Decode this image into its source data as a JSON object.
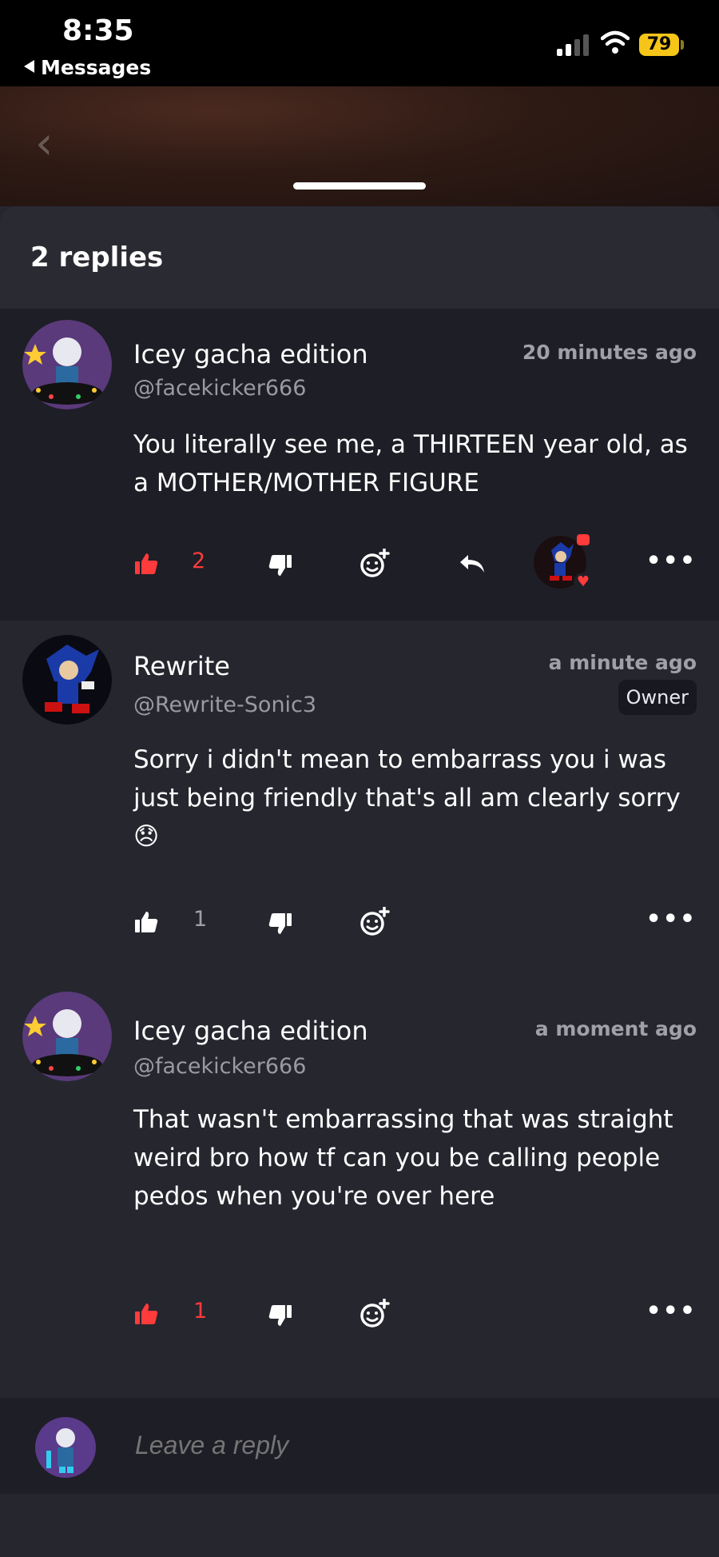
{
  "status_bar": {
    "time": "8:35",
    "back_label": "Messages",
    "battery": "79"
  },
  "sheet": {
    "replies_count": "2 replies"
  },
  "comments": [
    {
      "name": "Icey gacha edition",
      "handle": "@facekicker666",
      "time": "20 minutes ago",
      "body": "You literally see me, a THIRTEEN year old, as a MOTHER/MOTHER FIGURE",
      "likes": "2",
      "liked": true
    },
    {
      "name": "Rewrite",
      "handle": "@Rewrite-Sonic3",
      "time": "a minute ago",
      "badge": "Owner",
      "body": "Sorry i didn't mean to embarrass you i was just being friendly that's all am clearly sorry 😞",
      "likes": "1",
      "liked": false
    },
    {
      "name": "Icey gacha edition",
      "handle": "@facekicker666",
      "time": "a moment ago",
      "body": "That wasn't embarrassing that was straight weird bro how tf can you be calling people pedos when you're over here",
      "likes": "1",
      "liked": true
    }
  ],
  "reply_box": {
    "placeholder": "Leave a reply"
  },
  "colors": {
    "liked": "#ff3b3b",
    "sheet_bg": "#26262f",
    "highlight_bg": "#1e1e26"
  },
  "icons": [
    "thumbs-up-icon",
    "thumbs-down-icon",
    "add-reaction-icon",
    "reply-icon",
    "more-icon"
  ]
}
